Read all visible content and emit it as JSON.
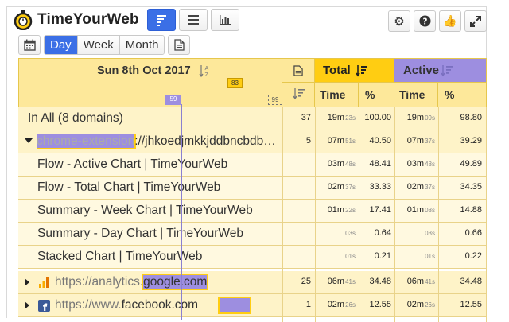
{
  "app": {
    "title": "TimeYourWeb"
  },
  "periods": [
    "Day",
    "Week",
    "Month"
  ],
  "header": {
    "date": "Sun 8th Oct 2017",
    "total_label": "Total",
    "active_label": "Active",
    "time_label": "Time",
    "pct_label": "%",
    "scale_ticks": [
      "59",
      "83",
      "99"
    ]
  },
  "rows": [
    {
      "label": "In All (8 domains)",
      "count": "37",
      "total_time": "19m",
      "total_sec": "23s",
      "total_pct": "100.00",
      "active_time": "19m",
      "active_sec": "09s",
      "active_pct": "98.80"
    },
    {
      "label_prefix": "chrome-extension",
      "label": "://jhkoedjmkkjddbncbdb…",
      "count": "5",
      "total_time": "07m",
      "total_sec": "51s",
      "total_pct": "40.50",
      "active_time": "07m",
      "active_sec": "37s",
      "active_pct": "39.29"
    },
    {
      "label": "Flow - Active Chart | TimeYourWeb",
      "total_time": "03m",
      "total_sec": "48s",
      "total_pct": "48.41",
      "active_time": "03m",
      "active_sec": "48s",
      "active_pct": "49.89"
    },
    {
      "label": "Flow - Total Chart | TimeYourWeb",
      "total_time": "02m",
      "total_sec": "37s",
      "total_pct": "33.33",
      "active_time": "02m",
      "active_sec": "37s",
      "active_pct": "34.35"
    },
    {
      "label": "Summary - Week Chart | TimeYourWeb",
      "total_time": "01m",
      "total_sec": "22s",
      "total_pct": "17.41",
      "active_time": "01m",
      "active_sec": "08s",
      "active_pct": "14.88"
    },
    {
      "label": "Summary - Day Chart | TimeYourWeb",
      "total_time": "",
      "total_sec": "03s",
      "total_pct": "0.64",
      "active_time": "",
      "active_sec": "03s",
      "active_pct": "0.66"
    },
    {
      "label": "Stacked Chart | TimeYourWeb",
      "total_time": "",
      "total_sec": "01s",
      "total_pct": "0.21",
      "active_time": "",
      "active_sec": "01s",
      "active_pct": "0.22"
    },
    {
      "label_prefix": "https://analytics.",
      "label": "google.com",
      "count": "25",
      "total_time": "06m",
      "total_sec": "41s",
      "total_pct": "34.48",
      "active_time": "06m",
      "active_sec": "41s",
      "active_pct": "34.48"
    },
    {
      "label_prefix": "https://www.",
      "label": "facebook.com",
      "count": "1",
      "total_time": "02m",
      "total_sec": "26s",
      "total_pct": "12.55",
      "active_time": "02m",
      "active_sec": "26s",
      "active_pct": "12.55"
    }
  ],
  "colors": {
    "accent": "#3b6fe6",
    "total": "#ffcd12",
    "active": "#9d8ee0",
    "header": "#fde89a"
  }
}
